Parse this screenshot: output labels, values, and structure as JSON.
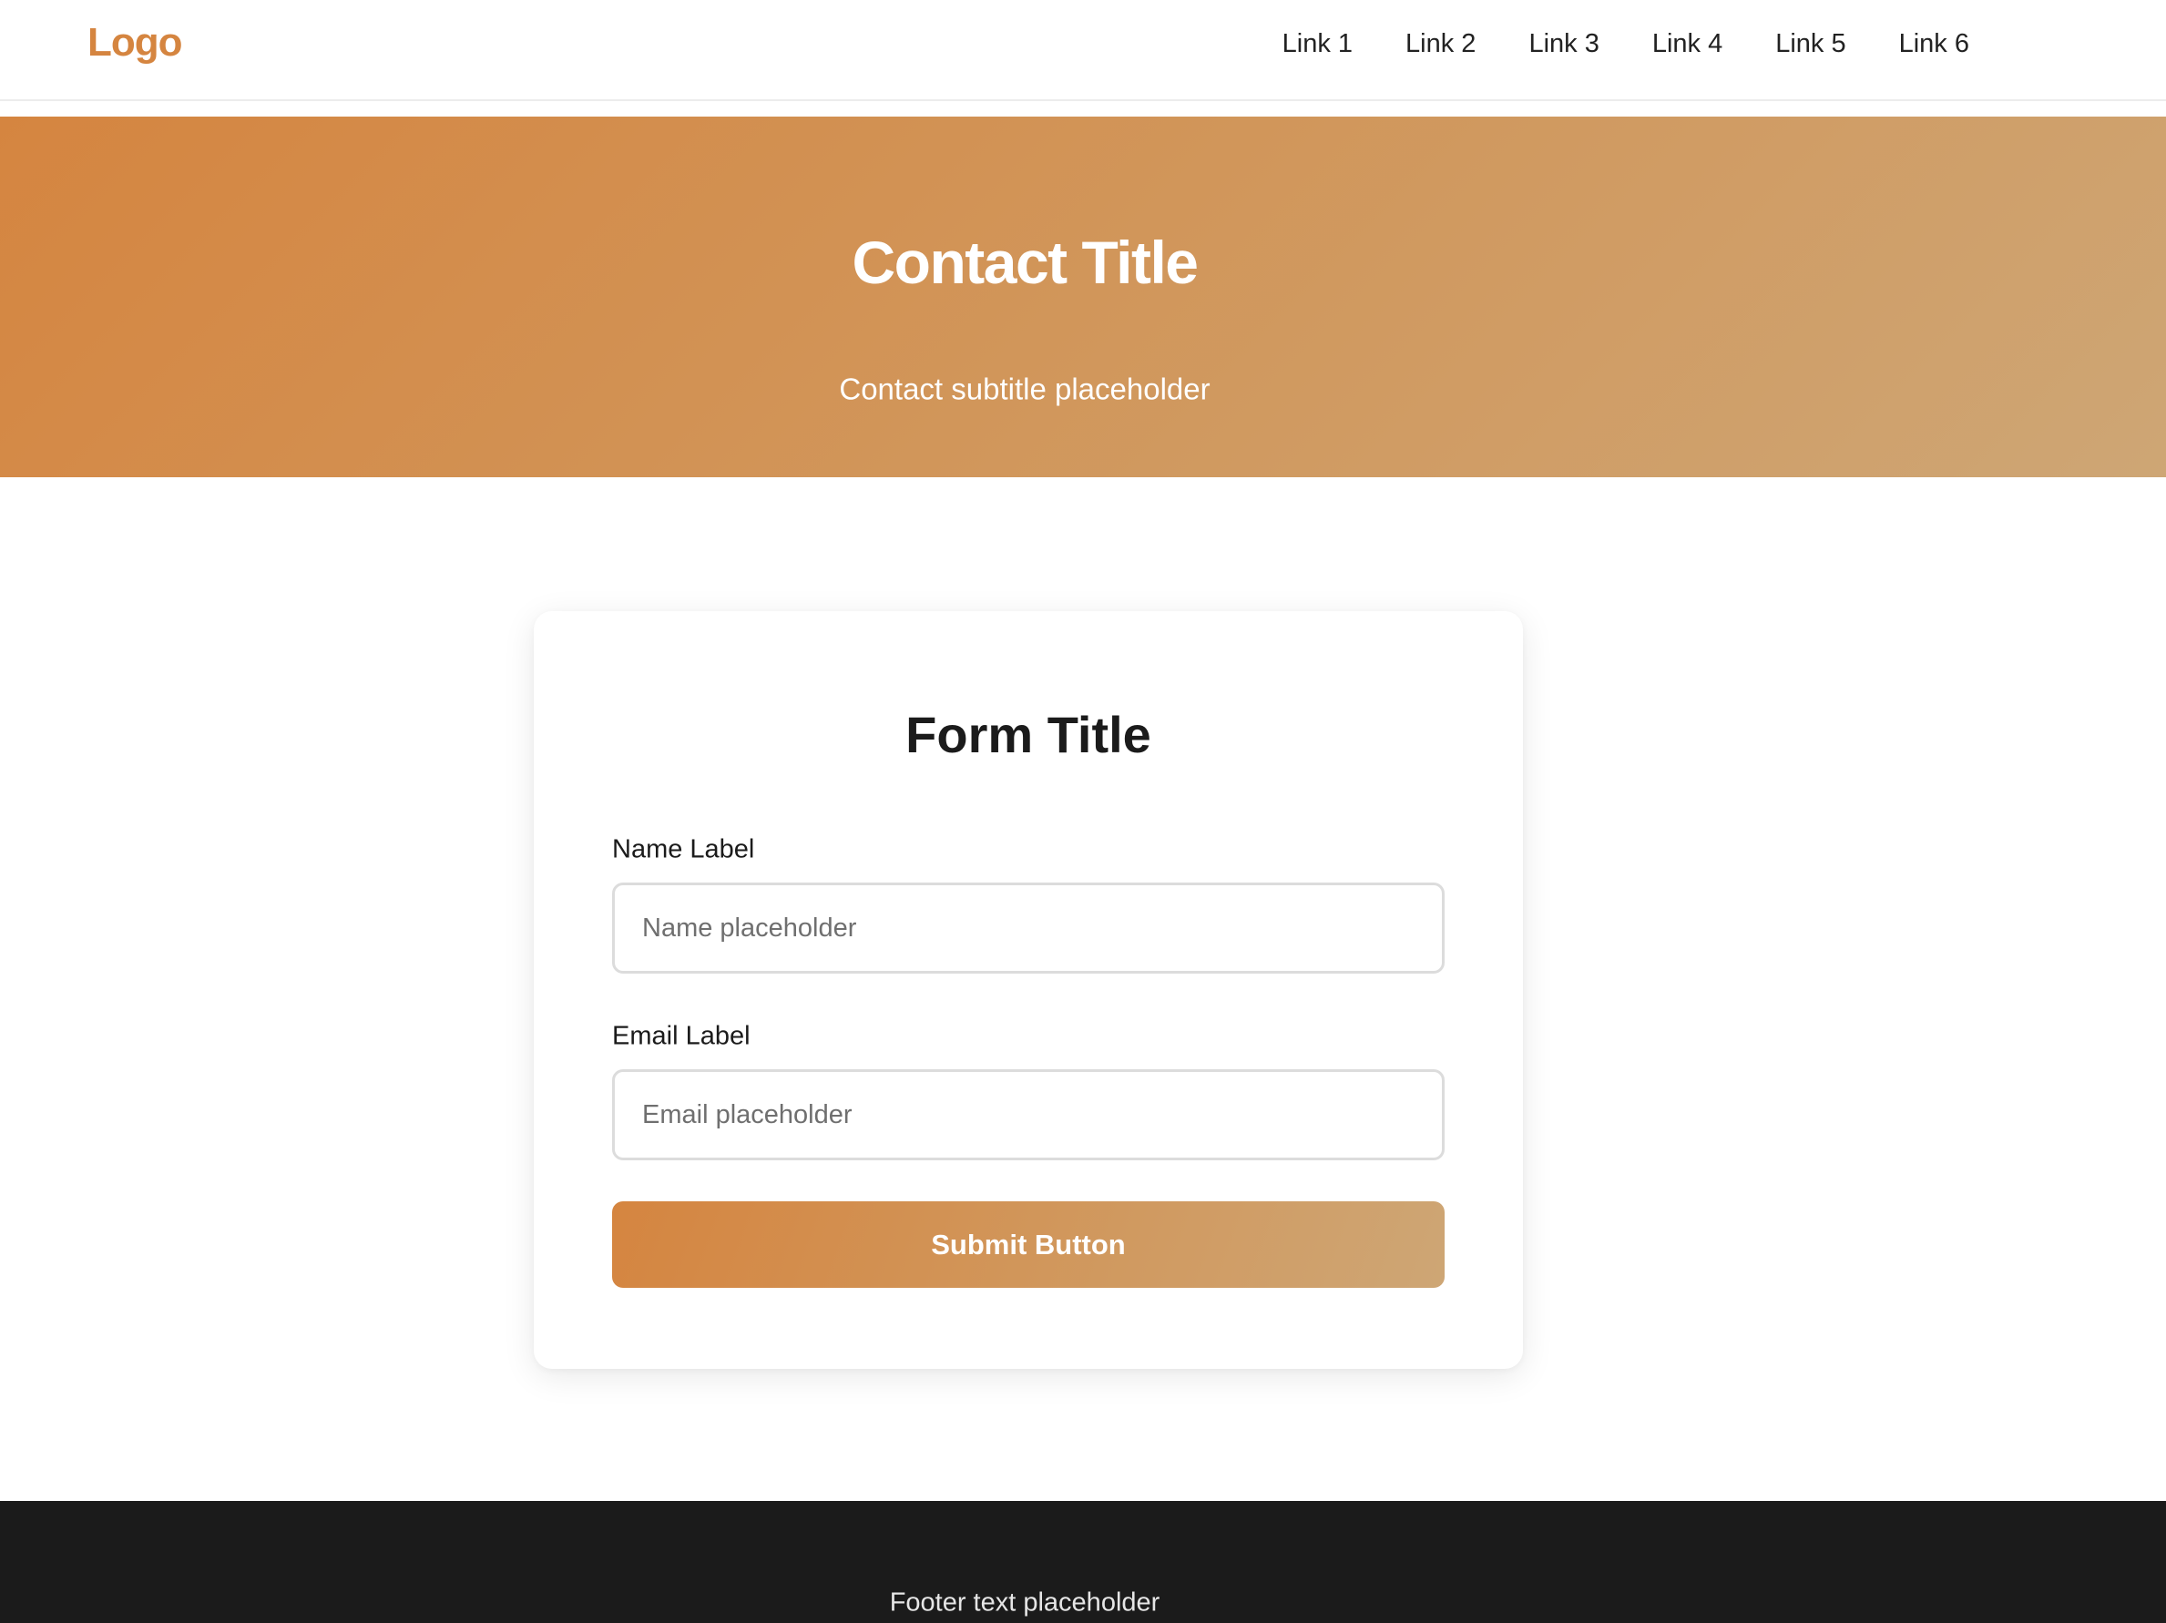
{
  "header": {
    "logo": "Logo",
    "nav": [
      "Link 1",
      "Link 2",
      "Link 3",
      "Link 4",
      "Link 5",
      "Link 6"
    ]
  },
  "hero": {
    "title": "Contact Title",
    "subtitle": "Contact subtitle placeholder"
  },
  "form": {
    "title": "Form Title",
    "name_label": "Name Label",
    "name_placeholder": "Name placeholder",
    "email_label": "Email Label",
    "email_placeholder": "Email placeholder",
    "submit_label": "Submit Button"
  },
  "footer": {
    "text": "Footer text placeholder"
  },
  "colors": {
    "accent": "#d58540",
    "accent_light": "#cea675",
    "footer_bg": "#1b1b1b"
  }
}
